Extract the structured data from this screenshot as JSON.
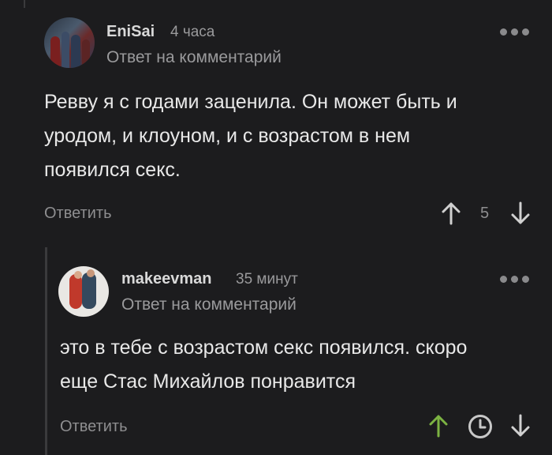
{
  "comments": [
    {
      "username": "EniSai",
      "time": "4 часа",
      "reply_to": "Ответ на комментарий",
      "text_lines": [
        "Ревву я с годами заценила. Он может быть и",
        "уродом, и клоуном, и с возрастом в нем",
        "появился секс."
      ],
      "reply_label": "Ответить",
      "rating": "5",
      "avatar_icon": "user-avatar",
      "upvote_color": "#d0d0d0"
    },
    {
      "username": "makeevman",
      "time": "35 минут",
      "reply_to": "Ответ на комментарий",
      "text_lines": [
        "это в тебе с возрастом секс появился. скоро",
        "еще Стас Михайлов понравится"
      ],
      "reply_label": "Ответить",
      "avatar_icon": "user-avatar",
      "upvote_color": "#7cb342"
    }
  ],
  "icons": {
    "more": "more-dots-icon",
    "upvote": "arrow-up-icon",
    "downvote": "arrow-down-icon",
    "clock": "clock-icon"
  }
}
